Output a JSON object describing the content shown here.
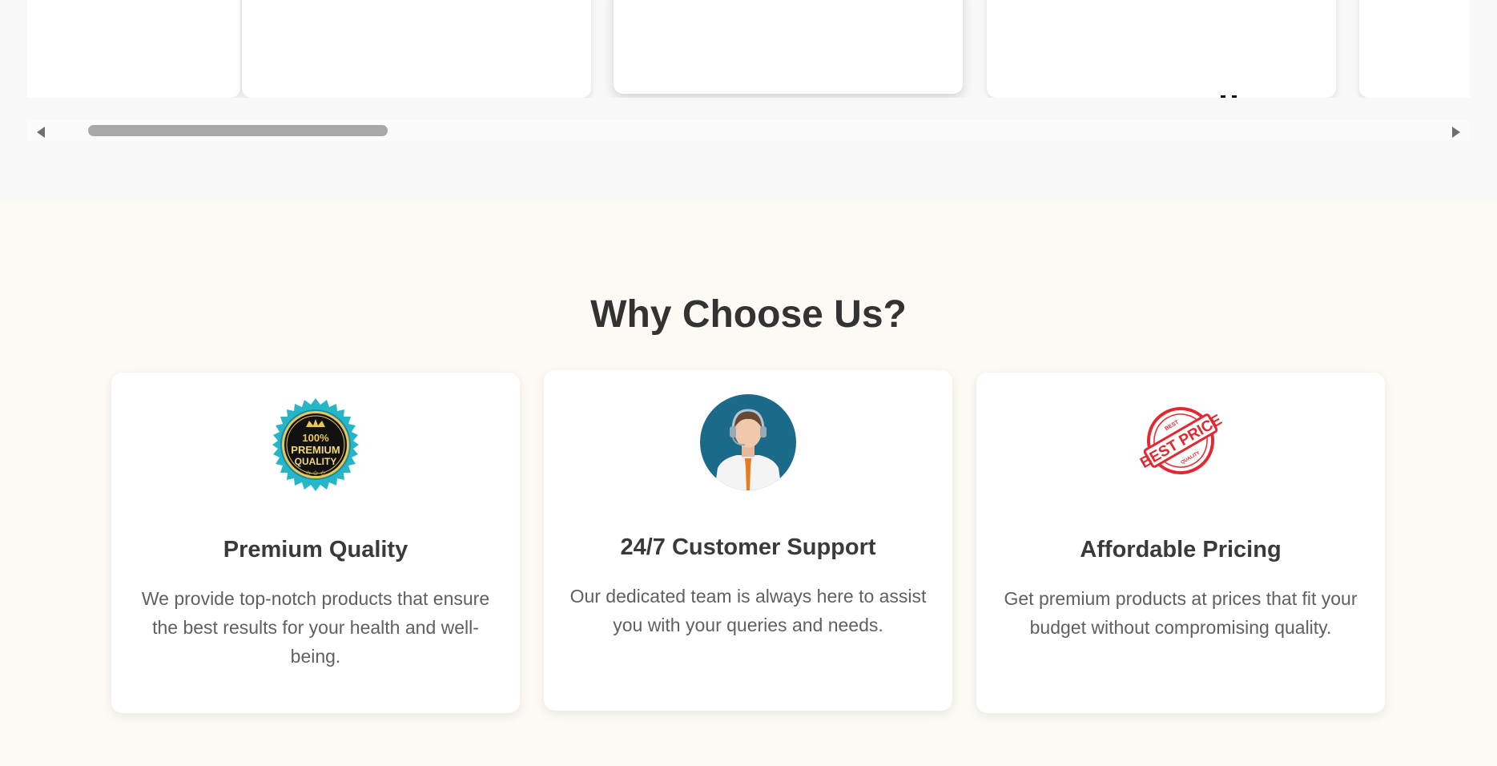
{
  "carousel": {
    "scroll_left_icon": "triangle-left-icon",
    "scroll_right_icon": "triangle-right-icon"
  },
  "why": {
    "title": "Why Choose Us?",
    "features": [
      {
        "icon": "premium-quality-badge",
        "title": "Premium Quality",
        "description": "We provide top-notch products that ensure the best results for your health and well-being.",
        "badge_text": [
          "100%",
          "PREMIUM",
          "QUALITY"
        ]
      },
      {
        "icon": "customer-support-agent",
        "title": "24/7 Customer Support",
        "description": "Our dedicated team is always here to assist you with your queries and needs."
      },
      {
        "icon": "best-price-stamp",
        "title": "Affordable Pricing",
        "description": "Get premium products at prices that fit your budget without compromising quality.",
        "badge_text": [
          "BEST",
          "BEST PRICE",
          "QUALITY"
        ]
      }
    ]
  },
  "colors": {
    "accent_teal": "#1b6a8a",
    "stamp_red": "#e3282f",
    "badge_gold": "#e9c75a"
  }
}
